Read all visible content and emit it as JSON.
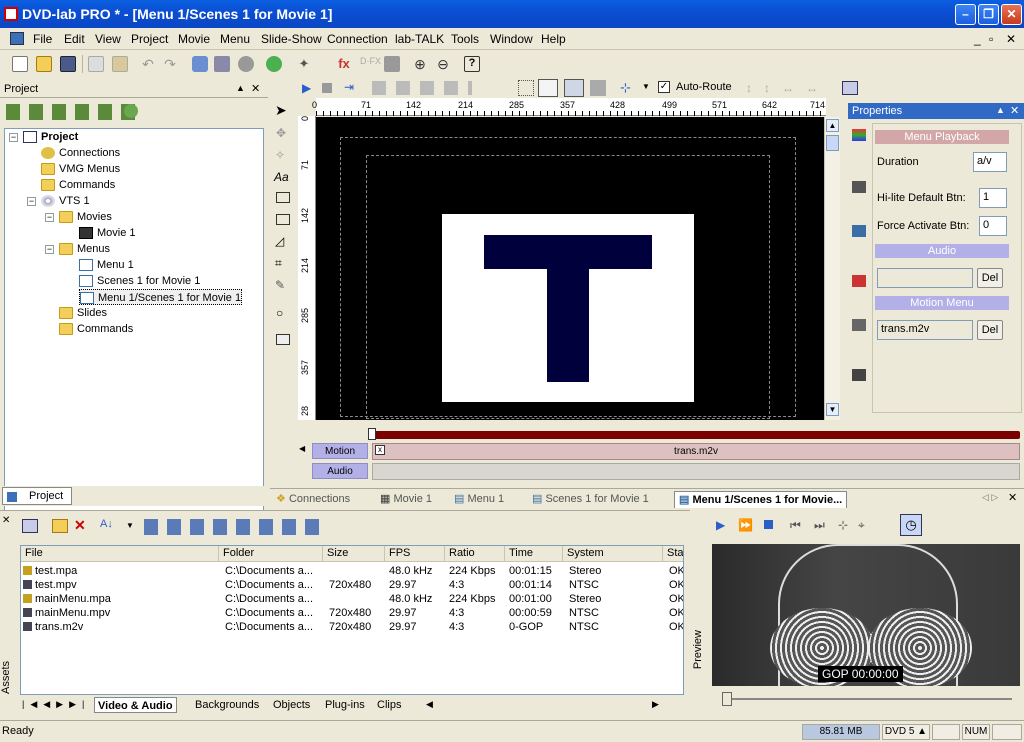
{
  "window": {
    "title": "DVD-lab PRO * - [Menu 1/Scenes 1 for Movie 1]"
  },
  "menubar": [
    "File",
    "Edit",
    "View",
    "Project",
    "Movie",
    "Menu",
    "Slide-Show",
    "Connection",
    "lab-TALK",
    "Tools",
    "Window",
    "Help"
  ],
  "toolbar": {
    "auto_route_label": "Auto-Route"
  },
  "project_panel": {
    "title": "Project",
    "tree": [
      "Project",
      "Connections",
      "VMG Menus",
      "Commands",
      "VTS 1",
      "Movies",
      "Movie 1",
      "Menus",
      "Menu 1",
      "Scenes 1 for Movie 1",
      "Menu 1/Scenes 1 for Movie 1",
      "Slides",
      "Commands"
    ],
    "tab_label": "Project"
  },
  "canvas": {
    "ruler_top": [
      "0",
      "71",
      "142",
      "214",
      "285",
      "357",
      "428",
      "499",
      "571",
      "642",
      "714"
    ],
    "ruler_left": [
      "0",
      "71",
      "142",
      "214",
      "285",
      "357",
      "28"
    ],
    "menu_letter": "T"
  },
  "properties": {
    "title": "Properties",
    "menu_playback": "Menu Playback",
    "duration_label": "Duration",
    "duration_value": "a/v",
    "hilite_label": "Hi-lite Default Btn:",
    "hilite_value": "1",
    "force_label": "Force Activate Btn:",
    "force_value": "0",
    "audio_section": "Audio",
    "audio_value": "",
    "del_label": "Del",
    "motion_section": "Motion Menu",
    "motion_value": "trans.m2v"
  },
  "timeline": {
    "motion_label": "Motion",
    "audio_label": "Audio",
    "motion_clip": "trans.m2v",
    "close_glyph": "x"
  },
  "doc_tabs": [
    "Connections",
    "Movie 1",
    "Menu 1",
    "Scenes 1 for Movie 1",
    "Menu 1/Scenes 1 for Movie..."
  ],
  "assets": {
    "side_label": "Assets",
    "columns": [
      "File",
      "Folder",
      "Size",
      "FPS",
      "Ratio",
      "Time",
      "System",
      "Sta"
    ],
    "rows": [
      [
        "test.mpa",
        "C:\\Documents a...",
        "",
        "48.0 kHz",
        "224 Kbps",
        "00:01:15",
        "Stereo",
        "OK"
      ],
      [
        "test.mpv",
        "C:\\Documents a...",
        "720x480",
        "29.97",
        "4:3",
        "00:01:14",
        "NTSC",
        "OK"
      ],
      [
        "mainMenu.mpa",
        "C:\\Documents a...",
        "",
        "48.0 kHz",
        "224 Kbps",
        "00:01:00",
        "Stereo",
        "OK"
      ],
      [
        "mainMenu.mpv",
        "C:\\Documents a...",
        "720x480",
        "29.97",
        "4:3",
        "00:00:59",
        "NTSC",
        "OK"
      ],
      [
        "trans.m2v",
        "C:\\Documents a...",
        "720x480",
        "29.97",
        "4:3",
        "0-GOP",
        "NTSC",
        "OK"
      ]
    ],
    "bottom_tabs": [
      "Video & Audio",
      "Backgrounds",
      "Objects",
      "Plug-ins",
      "Clips"
    ]
  },
  "preview": {
    "side_label": "Preview",
    "gop_text": "GOP 00:00:00"
  },
  "status": {
    "ready": "Ready",
    "memory": "85.81 MB",
    "disc": "DVD 5",
    "num": "NUM"
  },
  "colors": {
    "title_blue": "#0a52d6",
    "section_purple": "#b3b0e8",
    "timeline_red": "#7a0000",
    "menu_navy": "#00003c"
  }
}
